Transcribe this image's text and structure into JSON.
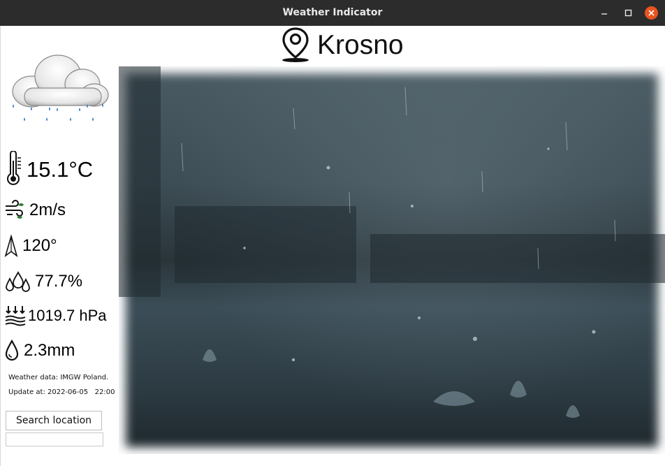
{
  "window": {
    "title": "Weather Indicator",
    "close_color": "#e95420"
  },
  "location": {
    "city": "Krosno",
    "icon": "map-pin-icon"
  },
  "current": {
    "condition_icon": "rain-cloud-icon",
    "temperature": "15.1°C",
    "wind_speed": "2m/s",
    "wind_direction": "120°",
    "humidity": "77.7%",
    "pressure": "1019.7 hPa",
    "precipitation": "2.3mm"
  },
  "footer": {
    "source": "Weather data: IMGW Poland.",
    "updated": "Update at: 2022-06-05   22:00"
  },
  "search": {
    "button_label": "Search  location",
    "input_value": "",
    "input_placeholder": ""
  },
  "background": {
    "subject": "rain-photo"
  }
}
